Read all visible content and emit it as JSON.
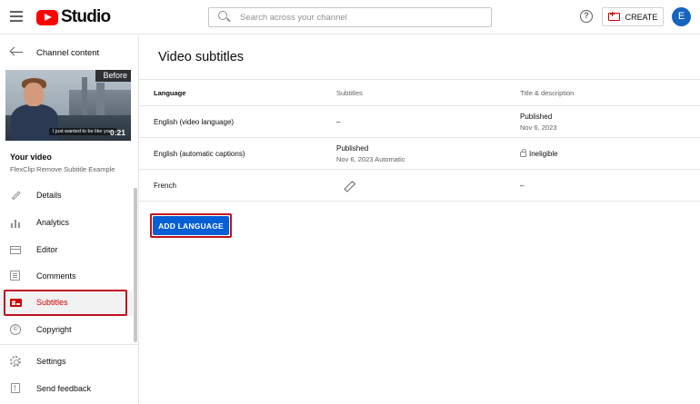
{
  "header": {
    "logo_text": "Studio",
    "search_placeholder": "Search across your channel",
    "help_symbol": "?",
    "create_label": "CREATE",
    "avatar_initial": "E"
  },
  "sidebar": {
    "back_label": "Channel content",
    "thumbnail": {
      "badge": "Before",
      "duration": "0:21",
      "caption": "I just wanted to be like you."
    },
    "your_video_label": "Your video",
    "video_name": "FlexClip Remove Subtitle Example",
    "items": [
      {
        "label": "Details",
        "icon": "pencil-icon"
      },
      {
        "label": "Analytics",
        "icon": "analytics-icon"
      },
      {
        "label": "Editor",
        "icon": "editor-icon"
      },
      {
        "label": "Comments",
        "icon": "comments-icon"
      },
      {
        "label": "Subtitles",
        "icon": "subtitles-icon",
        "active": true
      },
      {
        "label": "Copyright",
        "icon": "copyright-icon"
      }
    ],
    "bottom_items": [
      {
        "label": "Settings",
        "icon": "gear-icon"
      },
      {
        "label": "Send feedback",
        "icon": "feedback-icon"
      }
    ]
  },
  "main": {
    "title": "Video subtitles",
    "columns": [
      "Language",
      "Subtitles",
      "Title & description"
    ],
    "rows": [
      {
        "language": "English (video language)",
        "subtitles": "–",
        "subtitles_sub": "",
        "title_desc": "Published",
        "title_desc_sub": "Nov 6, 2023"
      },
      {
        "language": "English (automatic captions)",
        "subtitles": "Published",
        "subtitles_sub": "Nov 6, 2023 Automatic",
        "title_desc": "Ineligible",
        "title_desc_sub": ""
      },
      {
        "language": "French",
        "subtitles": "",
        "subtitles_sub": "",
        "title_desc": "–",
        "title_desc_sub": ""
      }
    ],
    "add_language_label": "ADD LANGUAGE"
  },
  "colors": {
    "accent": "#065fd4",
    "brand_red": "#ff0000",
    "active_red": "#cc0000",
    "highlight": "#c0111f"
  }
}
